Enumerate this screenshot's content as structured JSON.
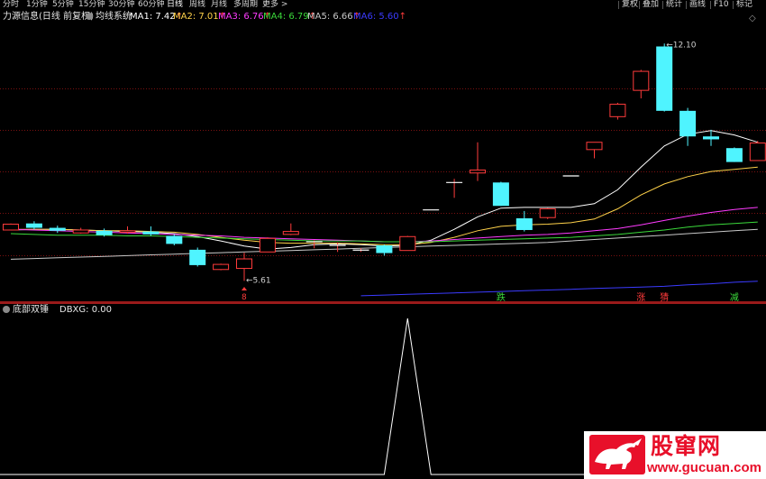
{
  "toolbar": {
    "periods": [
      "分时",
      "1分钟",
      "5分钟",
      "15分钟",
      "30分钟",
      "60分钟",
      "日线",
      "周线",
      "月线",
      "多周期",
      "更多 >"
    ],
    "active_period": "日线",
    "right_buttons": [
      "复权",
      "叠加",
      "统计",
      "画线",
      "F10",
      "标记"
    ]
  },
  "legend": {
    "title": "力源信息(日线 前复权)",
    "indicator": "均线系统",
    "ma": [
      {
        "label": "MA1: 7.42",
        "color": "#ffffff"
      },
      {
        "label": "MA2: 7.01",
        "color": "#ffd24a"
      },
      {
        "label": "MA3: 6.76",
        "color": "#ff3bff"
      },
      {
        "label": "MA4: 6.79",
        "color": "#3bd93b"
      },
      {
        "label": "MA5: 6.66",
        "color": "#c8c8c8"
      },
      {
        "label": "MA6: 5.60",
        "color": "#3b3bff"
      }
    ]
  },
  "sub_legend": {
    "title": "底部双锤",
    "value": "DBXG: 0.00"
  },
  "chart_data": {
    "type": "candlestick",
    "price_range": [
      5.1,
      12.6
    ],
    "high_label": "12.10",
    "low_label": "5.61",
    "candles": [
      {
        "o": 7.0,
        "c": 7.16,
        "h": 7.18,
        "l": 7.0
      },
      {
        "o": 7.18,
        "c": 7.06,
        "h": 7.24,
        "l": 7.02
      },
      {
        "o": 7.06,
        "c": 6.98,
        "h": 7.12,
        "l": 6.92
      },
      {
        "o": 6.92,
        "c": 7.0,
        "h": 7.06,
        "l": 6.9
      },
      {
        "o": 6.98,
        "c": 6.86,
        "h": 7.04,
        "l": 6.82
      },
      {
        "o": 6.94,
        "c": 6.98,
        "h": 7.1,
        "l": 6.9
      },
      {
        "o": 6.96,
        "c": 6.88,
        "h": 7.1,
        "l": 6.84
      },
      {
        "o": 6.84,
        "c": 6.62,
        "h": 6.88,
        "l": 6.58
      },
      {
        "o": 6.46,
        "c": 6.04,
        "h": 6.52,
        "l": 6.0
      },
      {
        "o": 5.92,
        "c": 6.06,
        "h": 6.08,
        "l": 5.9
      },
      {
        "o": 5.95,
        "c": 6.21,
        "h": 6.38,
        "l": 5.61
      },
      {
        "o": 6.4,
        "c": 6.77,
        "h": 6.8,
        "l": 6.4
      },
      {
        "o": 6.88,
        "c": 6.96,
        "h": 7.18,
        "l": 6.86
      },
      {
        "o": 6.68,
        "c": 6.68,
        "h": 6.72,
        "l": 6.5
      },
      {
        "o": 6.58,
        "c": 6.58,
        "h": 6.66,
        "l": 6.4
      },
      {
        "o": 6.45,
        "c": 6.45,
        "h": 6.5,
        "l": 6.4
      },
      {
        "o": 6.58,
        "c": 6.37,
        "h": 6.6,
        "l": 6.3
      },
      {
        "o": 6.44,
        "c": 6.82,
        "h": 6.84,
        "l": 6.44
      },
      {
        "o": 7.55,
        "c": 7.55,
        "h": 7.55,
        "l": 7.55
      },
      {
        "o": 8.3,
        "c": 8.3,
        "h": 8.4,
        "l": 7.88
      },
      {
        "o": 8.56,
        "c": 8.64,
        "h": 9.4,
        "l": 8.34
      },
      {
        "o": 8.3,
        "c": 7.66,
        "h": 8.32,
        "l": 7.66
      },
      {
        "o": 7.32,
        "c": 7.0,
        "h": 7.52,
        "l": 6.96
      },
      {
        "o": 7.34,
        "c": 7.58,
        "h": 7.6,
        "l": 7.3
      },
      {
        "o": 8.48,
        "c": 8.48,
        "h": 8.48,
        "l": 8.48
      },
      {
        "o": 9.2,
        "c": 9.4,
        "h": 9.4,
        "l": 8.96
      },
      {
        "o": 10.1,
        "c": 10.44,
        "h": 10.48,
        "l": 10.02
      },
      {
        "o": 10.82,
        "c": 11.34,
        "h": 11.38,
        "l": 10.6
      },
      {
        "o": 12.02,
        "c": 10.26,
        "h": 12.1,
        "l": 10.24
      },
      {
        "o": 10.26,
        "c": 9.56,
        "h": 10.34,
        "l": 9.3
      },
      {
        "o": 9.56,
        "c": 9.48,
        "h": 9.74,
        "l": 9.3
      },
      {
        "o": 9.24,
        "c": 8.86,
        "h": 9.26,
        "l": 8.86
      },
      {
        "o": 8.9,
        "c": 9.38,
        "h": 9.44,
        "l": 8.9
      }
    ],
    "ma_series": [
      {
        "name": "MA1",
        "color": "#ffffff",
        "values": [
          7.0,
          7.02,
          7.02,
          7.0,
          6.98,
          6.96,
          6.94,
          6.9,
          6.82,
          6.7,
          6.56,
          6.48,
          6.52,
          6.6,
          6.62,
          6.6,
          6.56,
          6.58,
          6.72,
          7.02,
          7.36,
          7.6,
          7.62,
          7.62,
          7.62,
          7.72,
          8.1,
          8.72,
          9.3,
          9.62,
          9.72,
          9.6,
          9.4
        ]
      },
      {
        "name": "MA2",
        "color": "#ffd24a",
        "values": [
          7.02,
          7.02,
          7.02,
          7.0,
          6.98,
          6.98,
          6.96,
          6.94,
          6.88,
          6.8,
          6.72,
          6.66,
          6.64,
          6.64,
          6.64,
          6.62,
          6.6,
          6.6,
          6.66,
          6.8,
          6.98,
          7.1,
          7.14,
          7.16,
          7.2,
          7.3,
          7.58,
          7.96,
          8.26,
          8.46,
          8.6,
          8.66,
          8.72
        ]
      },
      {
        "name": "MA3",
        "color": "#ff3bff",
        "values": [
          7.02,
          7.0,
          6.98,
          6.96,
          6.94,
          6.92,
          6.9,
          6.88,
          6.86,
          6.84,
          6.8,
          6.78,
          6.76,
          6.74,
          6.72,
          6.7,
          6.68,
          6.68,
          6.7,
          6.74,
          6.78,
          6.82,
          6.86,
          6.88,
          6.92,
          6.98,
          7.04,
          7.14,
          7.26,
          7.38,
          7.48,
          7.56,
          7.62
        ]
      },
      {
        "name": "MA4",
        "color": "#3bd93b",
        "values": [
          6.9,
          6.88,
          6.86,
          6.86,
          6.86,
          6.84,
          6.84,
          6.82,
          6.8,
          6.78,
          6.76,
          6.74,
          6.72,
          6.7,
          6.7,
          6.7,
          6.68,
          6.68,
          6.68,
          6.7,
          6.72,
          6.74,
          6.76,
          6.78,
          6.8,
          6.84,
          6.88,
          6.94,
          7.0,
          7.08,
          7.14,
          7.18,
          7.22
        ]
      },
      {
        "name": "MA5",
        "color": "#c8c8c8",
        "values": [
          6.2,
          6.22,
          6.24,
          6.26,
          6.28,
          6.3,
          6.32,
          6.34,
          6.36,
          6.38,
          6.4,
          6.42,
          6.44,
          6.46,
          6.48,
          6.5,
          6.52,
          6.54,
          6.56,
          6.58,
          6.6,
          6.62,
          6.64,
          6.66,
          6.7,
          6.74,
          6.78,
          6.82,
          6.86,
          6.9,
          6.94,
          6.98,
          7.02
        ]
      },
      {
        "name": "MA6",
        "color": "#3b3bff",
        "values": [
          null,
          null,
          null,
          null,
          null,
          null,
          null,
          null,
          null,
          null,
          null,
          null,
          null,
          null,
          null,
          5.2,
          5.22,
          5.24,
          5.26,
          5.28,
          5.3,
          5.32,
          5.34,
          5.36,
          5.38,
          5.4,
          5.42,
          5.44,
          5.46,
          5.5,
          5.53,
          5.57,
          5.6
        ]
      }
    ],
    "signals": [
      {
        "i": 10,
        "text": "8",
        "color": "#ff3b3b",
        "type": "up-arrow"
      },
      {
        "i": 21,
        "text": "跌",
        "color": "#3bd93b",
        "type": "label"
      },
      {
        "i": 27,
        "text": "涨",
        "color": "#ff3b3b",
        "type": "label"
      },
      {
        "i": 28,
        "text": "猜",
        "color": "#ff3b3b",
        "type": "label"
      },
      {
        "i": 31,
        "text": "减",
        "color": "#3bd93b",
        "type": "label"
      }
    ],
    "indicator": {
      "name": "DBXG",
      "range": [
        0,
        1
      ],
      "values": [
        0,
        0,
        0,
        0,
        0,
        0,
        0,
        0,
        0,
        0,
        0,
        0,
        0,
        0,
        0,
        0,
        0,
        1,
        0,
        0,
        0,
        0,
        0,
        0,
        0,
        0,
        0,
        0,
        0,
        0,
        0,
        0,
        0
      ]
    }
  },
  "colors": {
    "up": "#ff3b3b",
    "down": "#4ff4ff",
    "grid": "#7a1010",
    "indicator_line": "#ffffff"
  },
  "watermark": {
    "title": "股窜网",
    "url": "www.gucuan.com"
  }
}
